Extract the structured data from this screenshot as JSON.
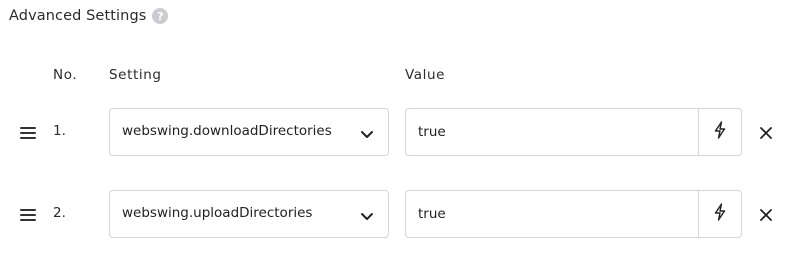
{
  "section": {
    "title": "Advanced Settings",
    "help_icon": "question-circle-icon",
    "help_glyph": "?"
  },
  "columns": {
    "no": "No.",
    "setting": "Setting",
    "value": "Value"
  },
  "rows": [
    {
      "number": "1.",
      "setting": "webswing.downloadDirectories",
      "value": "true",
      "icons": [
        "drag-handle-icon",
        "chevron-down-icon",
        "lightning-bolt-icon",
        "close-icon"
      ]
    },
    {
      "number": "2.",
      "setting": "webswing.uploadDirectories",
      "value": "true",
      "icons": [
        "drag-handle-icon",
        "chevron-down-icon",
        "lightning-bolt-icon",
        "close-icon"
      ]
    }
  ],
  "colors": {
    "border": "#d3d6da",
    "text": "#222222",
    "help_icon_bg": "#c9ccd1"
  }
}
